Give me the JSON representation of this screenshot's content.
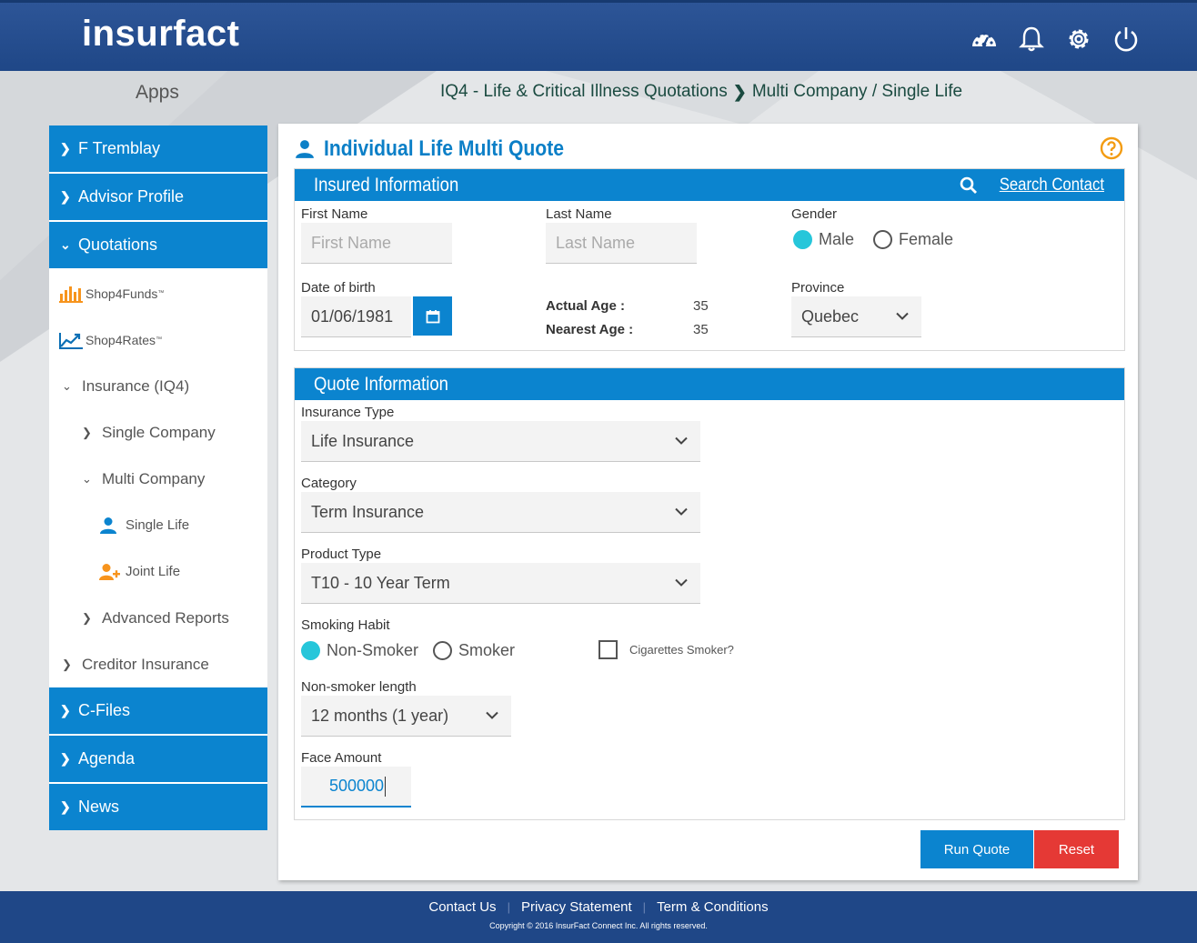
{
  "header": {
    "logo": "insurfact"
  },
  "apps_label": "Apps",
  "breadcrumb": {
    "section": "IQ4 - Life & Critical Illness Quotations",
    "page": "Multi Company / Single Life"
  },
  "sidebar": {
    "f_tremblay": "F Tremblay",
    "advisor_profile": "Advisor Profile",
    "quotations": "Quotations",
    "shop4funds": "Shop4Funds",
    "shop4rates": "Shop4Rates",
    "trademark": "™",
    "insurance_iq4": "Insurance (IQ4)",
    "single_company": "Single Company",
    "multi_company": "Multi Company",
    "single_life": "Single Life",
    "joint_life": "Joint Life",
    "advanced_reports": "Advanced Reports",
    "creditor_insurance": "Creditor Insurance",
    "c_files": "C-Files",
    "agenda": "Agenda",
    "news": "News"
  },
  "panel": {
    "title": "Individual Life Multi Quote"
  },
  "insured": {
    "heading": "Insured Information",
    "search_contact": "Search Contact",
    "first_name_label": "First Name",
    "first_name_placeholder": "First Name",
    "last_name_label": "Last Name",
    "last_name_placeholder": "Last Name",
    "gender_label": "Gender",
    "gender_male": "Male",
    "gender_female": "Female",
    "dob_label": "Date of birth",
    "dob_value": "01/06/1981",
    "actual_age_label": "Actual Age :",
    "actual_age_value": "35",
    "nearest_age_label": "Nearest Age :",
    "nearest_age_value": "35",
    "province_label": "Province",
    "province_value": "Quebec"
  },
  "quote": {
    "heading": "Quote Information",
    "insurance_type_label": "Insurance Type",
    "insurance_type_value": "Life Insurance",
    "category_label": "Category",
    "category_value": "Term Insurance",
    "product_type_label": "Product Type",
    "product_type_value": "T10 - 10 Year Term",
    "smoking_label": "Smoking Habit",
    "non_smoker": "Non-Smoker",
    "smoker": "Smoker",
    "cigarettes": "Cigarettes Smoker?",
    "nonsmoker_length_label": "Non-smoker length",
    "nonsmoker_length_value": "12 months (1 year)",
    "face_amount_label": "Face Amount",
    "face_amount_value": "500000"
  },
  "buttons": {
    "run_quote": "Run Quote",
    "reset": "Reset"
  },
  "footer": {
    "contact": "Contact Us",
    "privacy": "Privacy Statement",
    "terms": "Term & Conditions",
    "copyright": "Copyright © 2016 InsurFact Connect Inc. All rights reserved."
  },
  "colors": {
    "primary": "#0b84cf",
    "header": "#1f4787",
    "accent_radio": "#26c6da",
    "reset": "#e53935",
    "help": "#f39c12",
    "orange_icon": "#f7941d"
  }
}
